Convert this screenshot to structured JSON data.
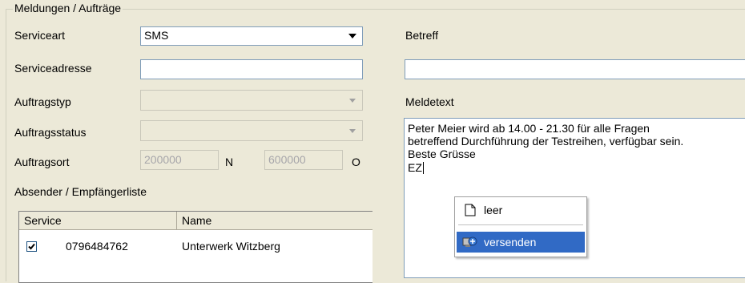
{
  "group": {
    "title": "Meldungen / Aufträge"
  },
  "form": {
    "serviceart": {
      "label": "Serviceart",
      "value": "SMS"
    },
    "serviceadresse": {
      "label": "Serviceadresse",
      "value": ""
    },
    "auftragstyp": {
      "label": "Auftragstyp",
      "value": ""
    },
    "auftragsstatus": {
      "label": "Auftragsstatus",
      "value": ""
    },
    "auftragsort": {
      "label": "Auftragsort",
      "north_value": "200000",
      "north_unit": "N",
      "east_value": "600000",
      "east_unit": "O"
    },
    "betreff": {
      "label": "Betreff",
      "value": ""
    },
    "meldetext": {
      "label": "Meldetext",
      "lines": [
        "Peter Meier wird ab 14.00 - 21.30 für alle Fragen",
        "betreffend Durchführung der Testreihen, verfügbar sein.",
        "Beste Grüsse",
        "EZ"
      ]
    }
  },
  "recipients": {
    "title": "Absender / Empfängerliste",
    "columns": [
      "Service",
      "Name"
    ],
    "rows": [
      {
        "checked": true,
        "service": "0796484762",
        "name": "Unterwerk Witzberg"
      }
    ]
  },
  "context_menu": {
    "items": [
      {
        "label": "leer",
        "icon": "page-icon",
        "selected": false
      },
      {
        "label": "versenden",
        "icon": "send-icon",
        "selected": true
      }
    ]
  },
  "colors": {
    "selection": "#316ac5",
    "field_border": "#7f9db9",
    "background": "#ece9d8"
  }
}
